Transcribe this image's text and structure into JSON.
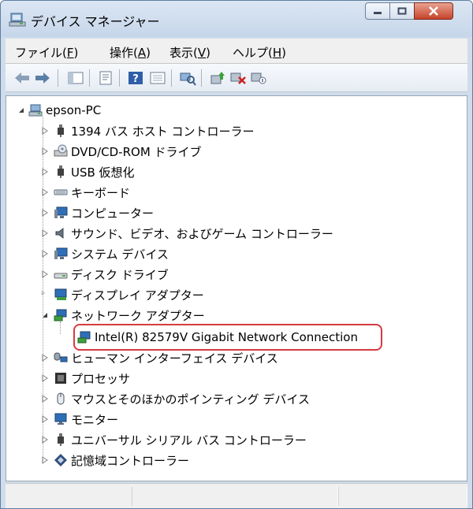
{
  "window": {
    "title": "デバイス マネージャー"
  },
  "menu": [
    {
      "label": "ファイル(",
      "key": "F",
      "suffix": ")"
    },
    {
      "label": "操作(",
      "key": "A",
      "suffix": ")"
    },
    {
      "label": "表示(",
      "key": "V",
      "suffix": ")"
    },
    {
      "label": "ヘルプ(",
      "key": "H",
      "suffix": ")"
    }
  ],
  "toolbar": {
    "icons": [
      "back-arrow-icon",
      "forward-arrow-icon",
      "console-tree-icon",
      "properties-icon",
      "help-icon",
      "view-icon",
      "scan-hardware-icon",
      "update-driver-icon",
      "uninstall-icon",
      "disable-icon"
    ]
  },
  "tree": {
    "root": "epson-PC",
    "categories": [
      {
        "label": "1394 バス ホスト コントローラー",
        "icon": "bus-controller-icon"
      },
      {
        "label": "DVD/CD-ROM ドライブ",
        "icon": "optical-drive-icon"
      },
      {
        "label": "USB 仮想化",
        "icon": "usb-icon"
      },
      {
        "label": "キーボード",
        "icon": "keyboard-icon"
      },
      {
        "label": "コンピューター",
        "icon": "computer-icon"
      },
      {
        "label": "サウンド、ビデオ、およびゲーム コントローラー",
        "icon": "speaker-icon"
      },
      {
        "label": "システム デバイス",
        "icon": "system-device-icon"
      },
      {
        "label": "ディスク ドライブ",
        "icon": "disk-drive-icon"
      },
      {
        "label": "ディスプレイ アダプター",
        "icon": "display-adapter-icon"
      },
      {
        "label": "ネットワーク アダプター",
        "icon": "network-adapter-icon",
        "expanded": true,
        "children": [
          {
            "label": "Intel(R) 82579V Gigabit Network Connection",
            "icon": "network-card-icon"
          }
        ]
      },
      {
        "label": "ヒューマン インターフェイス デバイス",
        "icon": "hid-icon"
      },
      {
        "label": "プロセッサ",
        "icon": "processor-icon"
      },
      {
        "label": "マウスとそのほかのポインティング デバイス",
        "icon": "mouse-icon"
      },
      {
        "label": "モニター",
        "icon": "monitor-icon"
      },
      {
        "label": "ユニバーサル シリアル バス コントローラー",
        "icon": "usb-controller-icon"
      },
      {
        "label": "記憶域コントローラー",
        "icon": "storage-controller-icon"
      }
    ]
  },
  "colors": {
    "highlight_border": "#d83a40",
    "close_button": "#c7432a"
  }
}
